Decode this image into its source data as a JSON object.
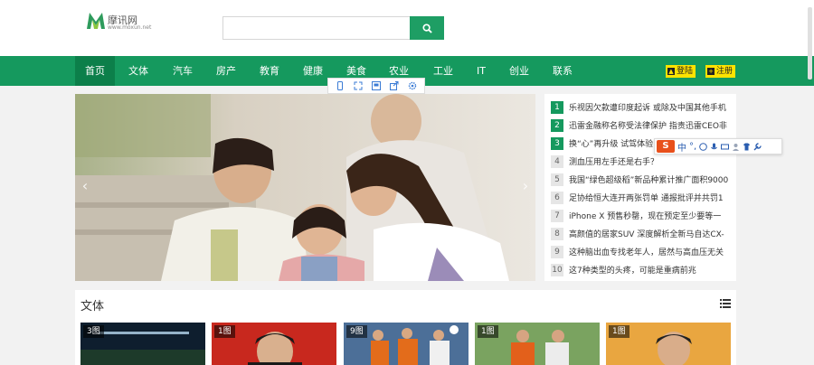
{
  "header": {
    "logo": {
      "name": "摩讯网",
      "url": "www.moxun.net"
    },
    "search": {
      "placeholder": "",
      "value": ""
    }
  },
  "nav": {
    "items": [
      {
        "label": "首页",
        "active": true
      },
      {
        "label": "文体"
      },
      {
        "label": "汽车"
      },
      {
        "label": "房产"
      },
      {
        "label": "教育"
      },
      {
        "label": "健康"
      },
      {
        "label": "美食"
      },
      {
        "label": "农业"
      },
      {
        "label": "工业"
      },
      {
        "label": "IT"
      },
      {
        "label": "创业"
      },
      {
        "label": "联系"
      }
    ],
    "login_label": "登陆",
    "register_label": "注册"
  },
  "image_toolbar": {
    "icons": [
      "phone-icon",
      "expand-icon",
      "save-image-icon",
      "share-icon",
      "settings-icon"
    ]
  },
  "news": {
    "items": [
      {
        "num": "1",
        "title": "乐视因欠款遭印度起诉 或除及中国其他手机"
      },
      {
        "num": "2",
        "title": "迅雷金融称名称受法律保护 指责迅雷CEO非"
      },
      {
        "num": "3",
        "title": "换“心”再升级 试驾体验"
      },
      {
        "num": "4",
        "title": "测血压用左手还是右手？"
      },
      {
        "num": "5",
        "title": "我国“绿色超级稻”新品种累计推广面积9000"
      },
      {
        "num": "6",
        "title": "足协给恒大连开两张罚单 通报批评并共罚1"
      },
      {
        "num": "7",
        "title": "iPhone X 预售秒罄，现在预定至少要等一"
      },
      {
        "num": "8",
        "title": "高颜值的居家SUV 深度解析全新马自达CX-"
      },
      {
        "num": "9",
        "title": "这种脑出血专找老年人，居然与高血压无关"
      },
      {
        "num": "10",
        "title": "这7种类型的头疼，可能是重病前兆"
      }
    ]
  },
  "ime": {
    "lang": "中",
    "punct": "°,"
  },
  "section": {
    "title": "文体",
    "thumbs": [
      {
        "badge": "3图"
      },
      {
        "badge": "1图"
      },
      {
        "badge": "9图"
      },
      {
        "badge": "1图"
      },
      {
        "badge": "1图"
      }
    ]
  },
  "colors": {
    "brand_green": "#15995e",
    "accent_yellow": "#ffe300",
    "ime_orange": "#e8501c"
  }
}
